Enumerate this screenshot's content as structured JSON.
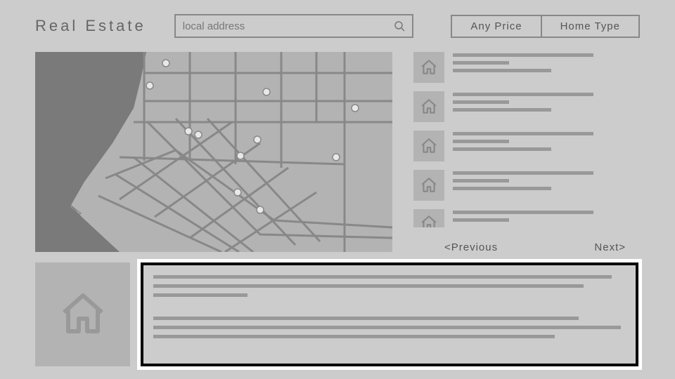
{
  "header": {
    "logo": "Real Estate",
    "search_placeholder": "local address"
  },
  "filters": {
    "price": "Any Price",
    "home_type": "Home Type"
  },
  "pagination": {
    "prev": "<Previous",
    "next": "Next>"
  },
  "icons": {
    "house": "house-icon",
    "search": "search-icon"
  },
  "listings": [
    {
      "id": 1
    },
    {
      "id": 2
    },
    {
      "id": 3
    },
    {
      "id": 4
    },
    {
      "id": 5
    }
  ]
}
